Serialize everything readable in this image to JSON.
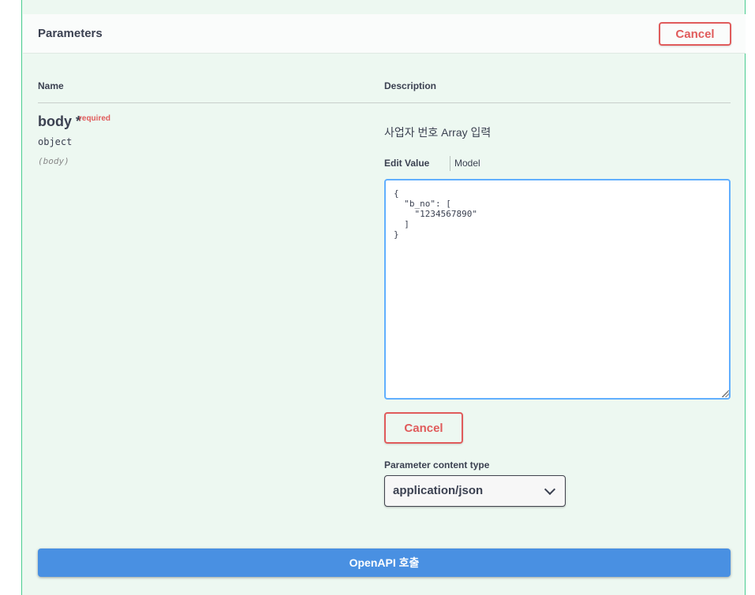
{
  "parameters": {
    "title": "Parameters",
    "cancel_label": "Cancel",
    "columns": {
      "name": "Name",
      "description": "Description"
    }
  },
  "param": {
    "name": "body *",
    "required_label": "required",
    "type": "object",
    "in": "(body)",
    "description": "사업자 번호 Array 입력",
    "tabs": {
      "edit_value": "Edit Value",
      "model": "Model"
    },
    "body_value": "{\n  \"b_no\": [\n    \"1234567890\"\n  ]\n}",
    "cancel_label": "Cancel"
  },
  "content_type": {
    "label": "Parameter content type",
    "selected": "application/json"
  },
  "execute": {
    "label": "OpenAPI 호출"
  },
  "colors": {
    "accent": "#49cc90",
    "cancel": "#e05b5b",
    "execute": "#4990e2",
    "editor_border": "#61affe"
  },
  "icons": {
    "select_arrow": "chevron-down-icon"
  }
}
